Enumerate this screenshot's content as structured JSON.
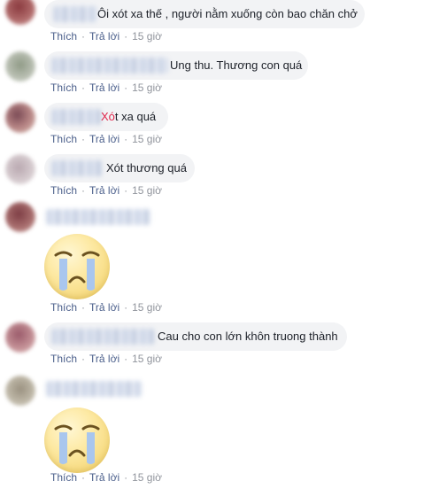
{
  "colors": {
    "bubble_bg": "#f2f3f5",
    "action_link": "#4b5f8b",
    "timestamp": "#90949c",
    "highlight": "#e0244a"
  },
  "comments": [
    {
      "text_prefix": "",
      "text_highlight": "",
      "text": "Ôi xót xa thế , người nằm xuống còn bao chăn chở",
      "like": "Thích",
      "reply": "Trả lời",
      "time": "15 giờ"
    },
    {
      "text_prefix": "",
      "text_highlight": "",
      "text": "Ung thu. Thương con quá",
      "like": "Thích",
      "reply": "Trả lời",
      "time": "15 giờ"
    },
    {
      "text_prefix": "",
      "text_highlight": "Xó",
      "text": "t xa quá",
      "like": "Thích",
      "reply": "Trả lời",
      "time": "15 giờ"
    },
    {
      "text_prefix": "",
      "text_highlight": "",
      "text": "Xót thương quá",
      "like": "Thích",
      "reply": "Trả lời",
      "time": "15 giờ"
    },
    {
      "sticker": "crying-face-sticker",
      "like": "Thích",
      "reply": "Trả lời",
      "time": "15 giờ"
    },
    {
      "text_prefix": "",
      "text_highlight": "",
      "text": "Cau cho con lớn khôn truong thành",
      "like": "Thích",
      "reply": "Trả lời",
      "time": "15 giờ"
    },
    {
      "sticker": "crying-face-sticker",
      "like": "Thích",
      "reply": "Trả lời",
      "time": "15 giờ"
    }
  ]
}
